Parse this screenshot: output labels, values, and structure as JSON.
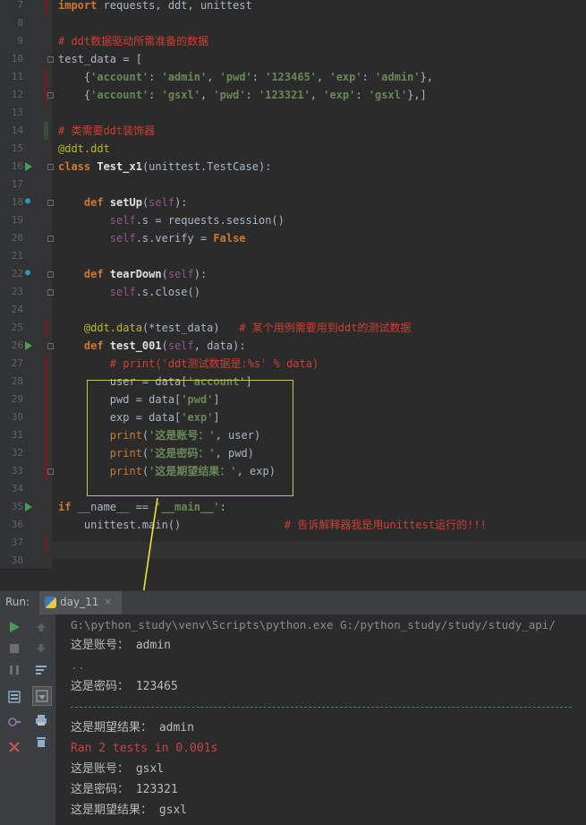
{
  "editor": {
    "lines": [
      {
        "n": "7",
        "tokens": [
          {
            "t": "import",
            "c": "kw"
          },
          {
            "t": " requests, ddt, unittest",
            "c": ""
          }
        ]
      },
      {
        "n": "8",
        "tokens": []
      },
      {
        "n": "9",
        "tokens": [
          {
            "t": "# ddt数据驱动所需准备的数据",
            "c": "cmt"
          }
        ]
      },
      {
        "n": "10",
        "tokens": [
          {
            "t": "test_data = [",
            "c": ""
          }
        ]
      },
      {
        "n": "11",
        "tokens": [
          {
            "t": "    {",
            "c": ""
          },
          {
            "t": "'account'",
            "c": "str"
          },
          {
            "t": ": ",
            "c": ""
          },
          {
            "t": "'admin'",
            "c": "str"
          },
          {
            "t": ", ",
            "c": ""
          },
          {
            "t": "'pwd'",
            "c": "str"
          },
          {
            "t": ": ",
            "c": ""
          },
          {
            "t": "'123465'",
            "c": "str"
          },
          {
            "t": ", ",
            "c": ""
          },
          {
            "t": "'exp'",
            "c": "str"
          },
          {
            "t": ": ",
            "c": ""
          },
          {
            "t": "'admin'",
            "c": "str"
          },
          {
            "t": "},",
            "c": ""
          }
        ]
      },
      {
        "n": "12",
        "tokens": [
          {
            "t": "    {",
            "c": ""
          },
          {
            "t": "'account'",
            "c": "str"
          },
          {
            "t": ": ",
            "c": ""
          },
          {
            "t": "'gsxl'",
            "c": "str"
          },
          {
            "t": ", ",
            "c": ""
          },
          {
            "t": "'pwd'",
            "c": "str"
          },
          {
            "t": ": ",
            "c": ""
          },
          {
            "t": "'123321'",
            "c": "str"
          },
          {
            "t": ", ",
            "c": ""
          },
          {
            "t": "'exp'",
            "c": "str"
          },
          {
            "t": ": ",
            "c": ""
          },
          {
            "t": "'gsxl'",
            "c": "str"
          },
          {
            "t": "},]",
            "c": ""
          }
        ]
      },
      {
        "n": "13",
        "tokens": []
      },
      {
        "n": "14",
        "tokens": [
          {
            "t": "# 类需要ddt装饰器",
            "c": "cmt"
          }
        ]
      },
      {
        "n": "15",
        "tokens": [
          {
            "t": "@ddt.ddt",
            "c": "dec"
          }
        ]
      },
      {
        "n": "16",
        "tokens": [
          {
            "t": "class ",
            "c": "kw"
          },
          {
            "t": "Test_x1",
            "c": "wht"
          },
          {
            "t": "(unittest.TestCase):",
            "c": ""
          }
        ]
      },
      {
        "n": "17",
        "tokens": []
      },
      {
        "n": "18",
        "tokens": [
          {
            "t": "    ",
            "c": ""
          },
          {
            "t": "def ",
            "c": "kw"
          },
          {
            "t": "setUp",
            "c": "wht"
          },
          {
            "t": "(",
            "c": ""
          },
          {
            "t": "self",
            "c": "self"
          },
          {
            "t": "):",
            "c": ""
          }
        ]
      },
      {
        "n": "19",
        "tokens": [
          {
            "t": "        ",
            "c": ""
          },
          {
            "t": "self",
            "c": "self"
          },
          {
            "t": ".s = requests.session()",
            "c": ""
          }
        ]
      },
      {
        "n": "20",
        "tokens": [
          {
            "t": "        ",
            "c": ""
          },
          {
            "t": "self",
            "c": "self"
          },
          {
            "t": ".s.verify = ",
            "c": ""
          },
          {
            "t": "False",
            "c": "kw"
          }
        ]
      },
      {
        "n": "21",
        "tokens": []
      },
      {
        "n": "22",
        "tokens": [
          {
            "t": "    ",
            "c": ""
          },
          {
            "t": "def ",
            "c": "kw"
          },
          {
            "t": "tearDown",
            "c": "wht"
          },
          {
            "t": "(",
            "c": ""
          },
          {
            "t": "self",
            "c": "self"
          },
          {
            "t": "):",
            "c": ""
          }
        ]
      },
      {
        "n": "23",
        "tokens": [
          {
            "t": "        ",
            "c": ""
          },
          {
            "t": "self",
            "c": "self"
          },
          {
            "t": ".s.close()",
            "c": ""
          }
        ]
      },
      {
        "n": "24",
        "tokens": []
      },
      {
        "n": "25",
        "tokens": [
          {
            "t": "    ",
            "c": ""
          },
          {
            "t": "@ddt.data",
            "c": "dec"
          },
          {
            "t": "(*test_data)   ",
            "c": ""
          },
          {
            "t": "# 某个用例需要用到ddt的测试数据",
            "c": "cmt"
          }
        ]
      },
      {
        "n": "26",
        "tokens": [
          {
            "t": "    ",
            "c": ""
          },
          {
            "t": "def ",
            "c": "kw"
          },
          {
            "t": "test_001",
            "c": "wht"
          },
          {
            "t": "(",
            "c": ""
          },
          {
            "t": "self",
            "c": "self"
          },
          {
            "t": ", data):",
            "c": ""
          }
        ]
      },
      {
        "n": "27",
        "tokens": [
          {
            "t": "        ",
            "c": ""
          },
          {
            "t": "# print('ddt测试数据是:%s' % data)",
            "c": "cmt"
          }
        ]
      },
      {
        "n": "28",
        "tokens": [
          {
            "t": "        user = data[",
            "c": ""
          },
          {
            "t": "'account'",
            "c": "str"
          },
          {
            "t": "]",
            "c": ""
          }
        ]
      },
      {
        "n": "29",
        "tokens": [
          {
            "t": "        pwd = data[",
            "c": ""
          },
          {
            "t": "'pwd'",
            "c": "str"
          },
          {
            "t": "]",
            "c": ""
          }
        ]
      },
      {
        "n": "30",
        "tokens": [
          {
            "t": "        exp = data[",
            "c": ""
          },
          {
            "t": "'exp'",
            "c": "str"
          },
          {
            "t": "]",
            "c": ""
          }
        ]
      },
      {
        "n": "31",
        "tokens": [
          {
            "t": "        ",
            "c": ""
          },
          {
            "t": "print",
            "c": "kwn"
          },
          {
            "t": "(",
            "c": ""
          },
          {
            "t": "'这是账号：'",
            "c": "str"
          },
          {
            "t": ", user)",
            "c": ""
          }
        ]
      },
      {
        "n": "32",
        "tokens": [
          {
            "t": "        ",
            "c": ""
          },
          {
            "t": "print",
            "c": "kwn"
          },
          {
            "t": "(",
            "c": ""
          },
          {
            "t": "'这是密码：'",
            "c": "str"
          },
          {
            "t": ", pwd)",
            "c": ""
          }
        ]
      },
      {
        "n": "33",
        "tokens": [
          {
            "t": "        ",
            "c": ""
          },
          {
            "t": "print",
            "c": "kwn"
          },
          {
            "t": "(",
            "c": ""
          },
          {
            "t": "'这是期望结果：'",
            "c": "str"
          },
          {
            "t": ", exp)",
            "c": ""
          }
        ]
      },
      {
        "n": "34",
        "tokens": []
      },
      {
        "n": "35",
        "tokens": [
          {
            "t": "if ",
            "c": "kw"
          },
          {
            "t": "__name__ == ",
            "c": ""
          },
          {
            "t": "'__main__'",
            "c": "str"
          },
          {
            "t": ":",
            "c": ""
          }
        ]
      },
      {
        "n": "36",
        "tokens": [
          {
            "t": "    unittest.main()                ",
            "c": ""
          },
          {
            "t": "# 告诉解释器我是用unittest运行的!!!",
            "c": "cmt"
          }
        ]
      },
      {
        "n": "37",
        "tokens": []
      },
      {
        "n": "38",
        "tokens": []
      }
    ]
  },
  "run_panel": {
    "label": "Run:",
    "tab_name": "day_11",
    "tab_close": "×"
  },
  "console": {
    "lines": [
      {
        "text": "G:\\python_study\\venv\\Scripts\\python.exe G:/python_study/study/study_api/",
        "kind": "path"
      },
      {
        "text": "这是账号： admin",
        "kind": "out"
      },
      {
        "text": "..",
        "kind": "err"
      },
      {
        "text": "这是密码： 123465",
        "kind": "out"
      },
      {
        "text": "",
        "kind": "dash"
      },
      {
        "text": "这是期望结果： admin",
        "kind": "out"
      },
      {
        "text": "Ran 2 tests in 0.001s",
        "kind": "err"
      },
      {
        "text": "这是账号： gsxl",
        "kind": "out"
      },
      {
        "text": "这是密码： 123321",
        "kind": "out"
      },
      {
        "text": "这是期望结果： gsxl",
        "kind": "out"
      }
    ]
  },
  "colors": {
    "editor_bg": "#2b2b2b",
    "keyword": "#cc7832",
    "string": "#6a8759",
    "comment": "#cc4033",
    "decorator": "#bbb529",
    "self": "#94558d",
    "highlight_box": "#c8c850",
    "arrow": "#e8e82a"
  }
}
